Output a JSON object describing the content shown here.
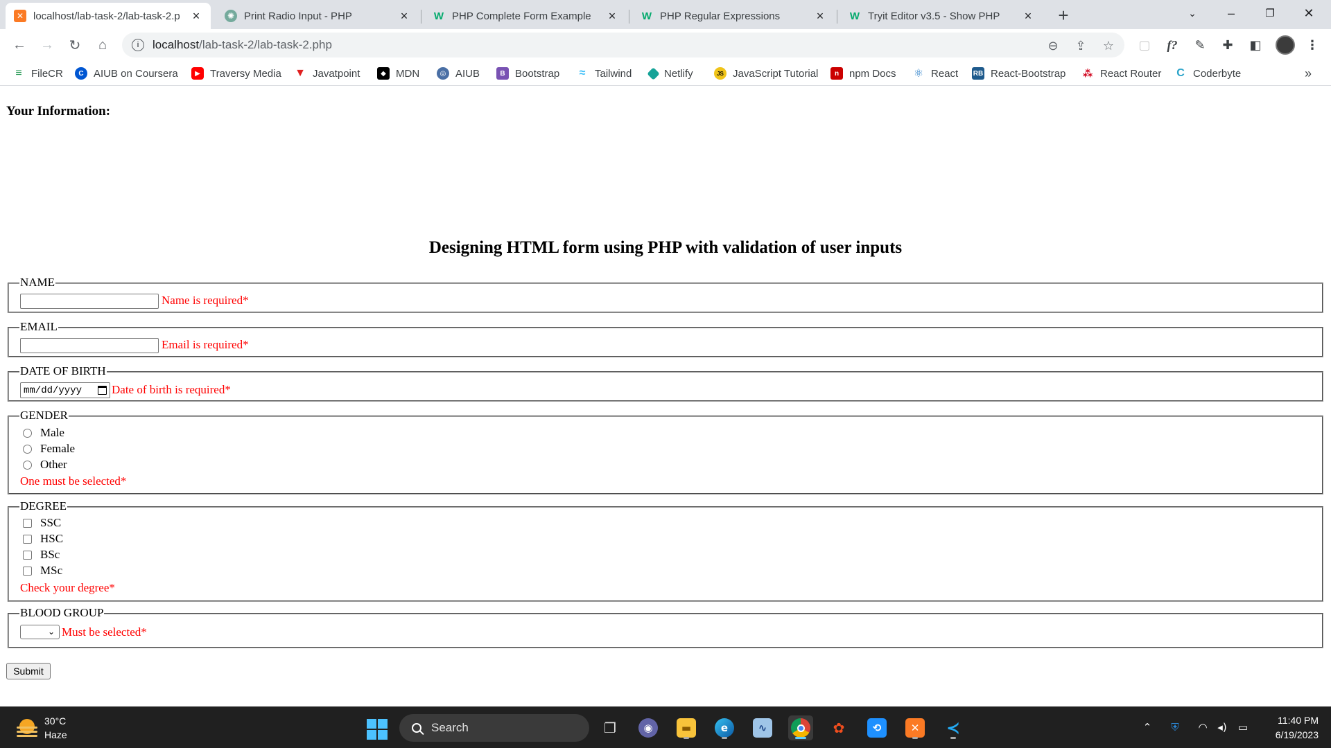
{
  "browser": {
    "tabs": [
      {
        "title": "localhost/lab-task-2/lab-task-2.p",
        "favicon": "xampp-icon",
        "active": true
      },
      {
        "title": "Print Radio Input - PHP",
        "favicon": "chatgpt-icon",
        "active": false
      },
      {
        "title": "PHP Complete Form Example",
        "favicon": "w3schools-icon",
        "active": false
      },
      {
        "title": "PHP Regular Expressions",
        "favicon": "w3schools-icon",
        "active": false
      },
      {
        "title": "Tryit Editor v3.5 - Show PHP",
        "favicon": "w3schools-icon",
        "active": false
      }
    ],
    "address": {
      "host": "localhost",
      "path": "/lab-task-2/lab-task-2.php"
    },
    "bookmarks": [
      {
        "label": "FileCR",
        "icon": "filecr-icon",
        "color": "#2e9d5a"
      },
      {
        "label": "AIUB on Coursera",
        "icon": "coursera-icon",
        "color": "#0056d2"
      },
      {
        "label": "Traversy Media",
        "icon": "youtube-icon",
        "color": "#ff0000"
      },
      {
        "label": "Javatpoint",
        "icon": "javatpoint-icon",
        "color": "#e02020"
      },
      {
        "label": "MDN",
        "icon": "mdn-icon",
        "color": "#000000"
      },
      {
        "label": "AIUB",
        "icon": "aiub-icon",
        "color": "#4a6fa5"
      },
      {
        "label": "Bootstrap",
        "icon": "bootstrap-icon",
        "color": "#7952b3"
      },
      {
        "label": "Tailwind",
        "icon": "tailwind-icon",
        "color": "#38bdf8"
      },
      {
        "label": "Netlify",
        "icon": "netlify-icon",
        "color": "#15a398"
      },
      {
        "label": "JavaScript Tutorial",
        "icon": "js-icon",
        "color": "#f0c419"
      },
      {
        "label": "npm Docs",
        "icon": "npm-icon",
        "color": "#cb0000"
      },
      {
        "label": "React",
        "icon": "react-icon",
        "color": "#2a7fc9"
      },
      {
        "label": "React-Bootstrap",
        "icon": "react-bootstrap-icon",
        "color": "#1e5a8c"
      },
      {
        "label": "React Router",
        "icon": "react-router-icon",
        "color": "#d0021b"
      },
      {
        "label": "Coderbyte",
        "icon": "coderbyte-icon",
        "color": "#29a3c9"
      }
    ]
  },
  "page": {
    "info_heading": "Your Information:",
    "form_title": "Designing HTML form using PHP with validation of user inputs",
    "name": {
      "legend": "NAME",
      "error": "Name is required*"
    },
    "email": {
      "legend": "EMAIL",
      "error": "Email is required*"
    },
    "dob": {
      "legend": "DATE OF BIRTH",
      "placeholder": "mm/dd/yyyy",
      "error": "Date of birth is required*"
    },
    "gender": {
      "legend": "GENDER",
      "options": [
        "Male",
        "Female",
        "Other"
      ],
      "error": "One must be selected*"
    },
    "degree": {
      "legend": "DEGREE",
      "options": [
        "SSC",
        "HSC",
        "BSc",
        "MSc"
      ],
      "error": "Check your degree*"
    },
    "blood_group": {
      "legend": "BLOOD GROUP",
      "error": "Must be selected*"
    },
    "submit_label": "Submit"
  },
  "taskbar": {
    "weather_temp": "30°C",
    "weather_desc": "Haze",
    "search_label": "Search",
    "time": "11:40 PM",
    "date": "6/19/2023"
  },
  "colors": {
    "error": "#ff0000",
    "accent": "#1a73e8",
    "taskbar_bg": "#202020"
  }
}
